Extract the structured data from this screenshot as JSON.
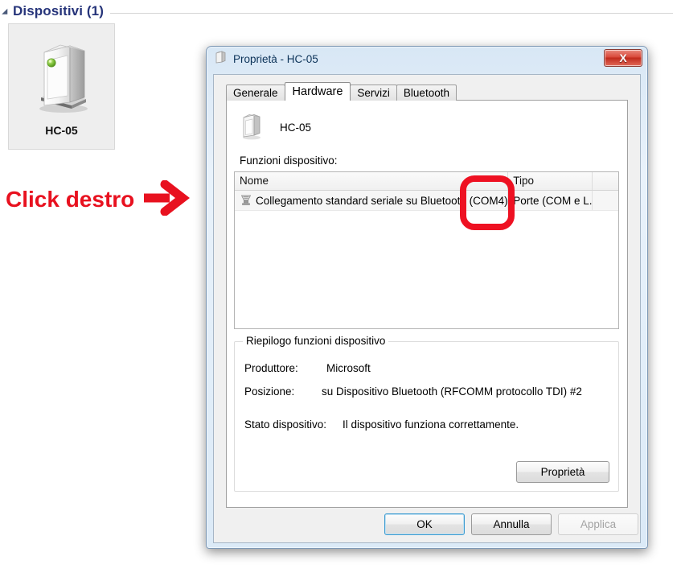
{
  "devices_page": {
    "section_title": "Dispositivi (1)",
    "collapse_icon": "triangle-collapse-icon",
    "tile": {
      "label": "HC-05",
      "icon": "computer-tower-icon"
    }
  },
  "annotation": {
    "text": "Click destro",
    "arrow_icon": "right-arrow-icon",
    "color": "#e8111f",
    "highlight_color": "#ee1122",
    "highlight_target": "(COM4)"
  },
  "dialog": {
    "title": "Proprietà - HC-05",
    "title_icon": "device-icon",
    "close_label": "X",
    "tabs": [
      {
        "label": "Generale",
        "active": false
      },
      {
        "label": "Hardware",
        "active": true
      },
      {
        "label": "Servizi",
        "active": false
      },
      {
        "label": "Bluetooth",
        "active": false
      }
    ],
    "hardware_tab": {
      "device_name": "HC-05",
      "device_icon": "computer-tower-icon",
      "functions_label": "Funzioni dispositivo:",
      "list": {
        "columns": [
          "Nome",
          "Tipo",
          ""
        ],
        "rows": [
          {
            "icon": "serial-port-icon",
            "name": "Collegamento standard seriale su Bluetooth (COM4)",
            "type": "Porte (COM e L...",
            "extra": ""
          }
        ]
      },
      "summary": {
        "legend": "Riepilogo funzioni dispositivo",
        "manufacturer_key": "Produttore:",
        "manufacturer_value": "Microsoft",
        "location_key": "Posizione:",
        "location_value": "su Dispositivo Bluetooth (RFCOMM protocollo TDI) #2",
        "status_key": "Stato dispositivo:",
        "status_value": "Il dispositivo funziona correttamente.",
        "properties_button": "Proprietà"
      }
    },
    "footer": {
      "ok": "OK",
      "cancel": "Annulla",
      "apply": "Applica"
    }
  }
}
